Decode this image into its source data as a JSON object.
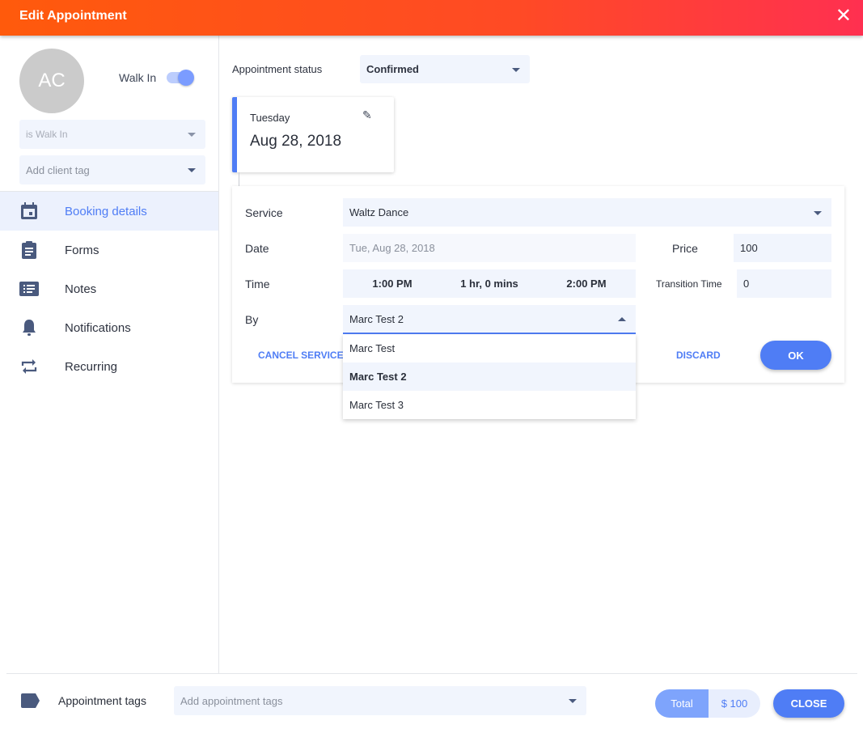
{
  "header": {
    "title": "Edit Appointment",
    "close_icon": "close-icon"
  },
  "client": {
    "initials": "AC",
    "walk_in_label": "Walk In",
    "walk_in_on": true,
    "walk_in_select_placeholder": "is Walk In",
    "client_tag_placeholder": "Add client tag"
  },
  "sidebar": {
    "items": [
      {
        "label": "Booking details",
        "icon": "calendar-icon",
        "active": true
      },
      {
        "label": "Forms",
        "icon": "clipboard-icon"
      },
      {
        "label": "Notes",
        "icon": "list-icon"
      },
      {
        "label": "Notifications",
        "icon": "bell-icon"
      },
      {
        "label": "Recurring",
        "icon": "repeat-icon"
      }
    ]
  },
  "status": {
    "label": "Appointment status",
    "value": "Confirmed"
  },
  "date_card": {
    "weekday": "Tuesday",
    "date": "Aug 28, 2018"
  },
  "form": {
    "service_label": "Service",
    "service_value": "Waltz Dance",
    "date_label": "Date",
    "date_value": "Tue, Aug 28, 2018",
    "price_label": "Price",
    "price_value": "100",
    "time_label": "Time",
    "start_time": "1:00 PM",
    "duration": "1 hr, 0 mins",
    "end_time": "2:00 PM",
    "transition_label": "Transition Time",
    "transition_value": "0",
    "by_label": "By",
    "by_value": "Marc Test 2",
    "by_options": [
      "Marc Test",
      "Marc Test 2",
      "Marc Test 3"
    ],
    "cancel_service": "CANCEL SERVICE",
    "discard": "DISCARD",
    "ok": "OK"
  },
  "footer": {
    "tags_label": "Appointment tags",
    "tags_placeholder": "Add appointment tags",
    "total_label": "Total",
    "total_value": "$ 100",
    "close": "CLOSE"
  },
  "colors": {
    "accent": "#4f7df5",
    "header_start": "#ff5a0c",
    "header_end": "#ff3050"
  }
}
